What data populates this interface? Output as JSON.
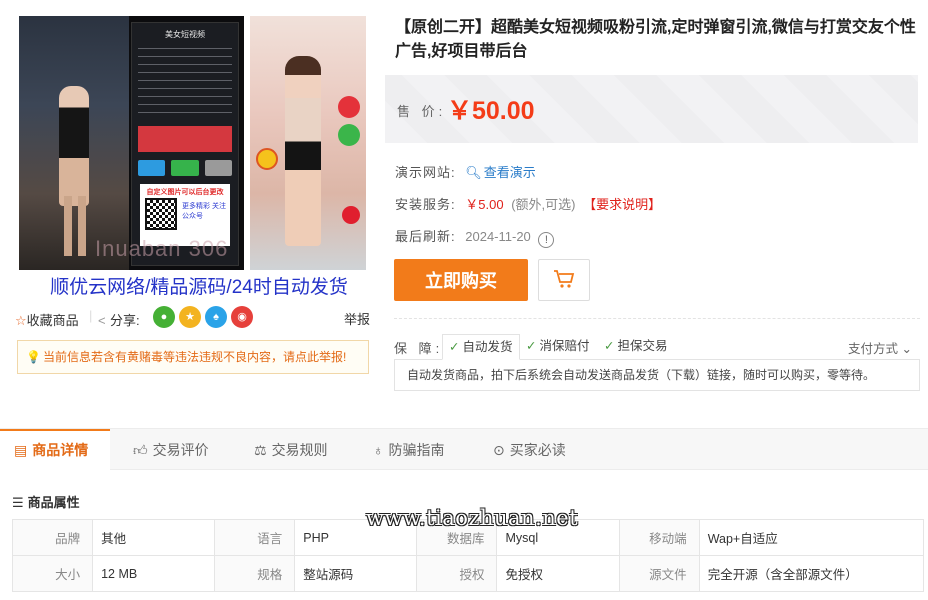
{
  "gallery": {
    "phone_title": "美女短视频",
    "phone_card_title": "自定义图片可以后台更改",
    "phone_card_side": "更多精彩 关注公众号",
    "image_watermark": "Inuaban 306",
    "shop_line": "顺优云网络/精品源码/24时自动发货"
  },
  "actions": {
    "favorite": "收藏商品",
    "share": "分享:",
    "report": "举报",
    "social_icons": [
      "wechat-icon",
      "qzone-icon",
      "qq-icon",
      "weibo-icon"
    ],
    "notice": "当前信息若含有黄赌毒等违法违规不良内容，请点此举报!"
  },
  "product": {
    "title": "【原创二开】超酷美女短视频吸粉引流,定时弹窗引流,微信与打赏交友个性广告,好项目带后台",
    "price_label": "售 价:",
    "price": "￥50.00",
    "demo_label": "演示网站:",
    "demo_link": "查看演示",
    "install_label": "安装服务:",
    "install_price": "￥5.00",
    "install_note": "(额外,可选)",
    "install_link": "【要求说明】",
    "refresh_label": "最后刷新:",
    "refresh_date": "2024-11-20",
    "buy_button": "立即购买"
  },
  "guarantee": {
    "label": "保 障:",
    "tabs": [
      "自动发货",
      "消保赔付",
      "担保交易"
    ],
    "payment": "支付方式",
    "description": "自动发货商品，拍下后系统会自动发送商品发货（下载）链接，随时可以购买，零等待。"
  },
  "tabs": [
    {
      "label": "商品详情",
      "icon": "document-icon"
    },
    {
      "label": "交易评价",
      "icon": "thumbs-up-icon"
    },
    {
      "label": "交易规则",
      "icon": "scale-icon"
    },
    {
      "label": "防骗指南",
      "icon": "bulb-icon"
    },
    {
      "label": "买家必读",
      "icon": "compass-icon"
    }
  ],
  "attributes": {
    "title": "商品属性",
    "watermark": "www.tiaozhuan.net",
    "rows": [
      [
        [
          "品牌",
          "其他"
        ],
        [
          "语言",
          "PHP"
        ],
        [
          "数据库",
          "Mysql"
        ],
        [
          "移动端",
          "Wap+自适应"
        ]
      ],
      [
        [
          "大小",
          "12 MB"
        ],
        [
          "规格",
          "整站源码"
        ],
        [
          "授权",
          "免授权"
        ],
        [
          "源文件",
          "完全开源（含全部源文件）"
        ]
      ]
    ]
  },
  "colors": {
    "accent": "#f27b1a",
    "price": "#f43c18",
    "link": "#2a7cc9",
    "check": "#4a9a42"
  }
}
